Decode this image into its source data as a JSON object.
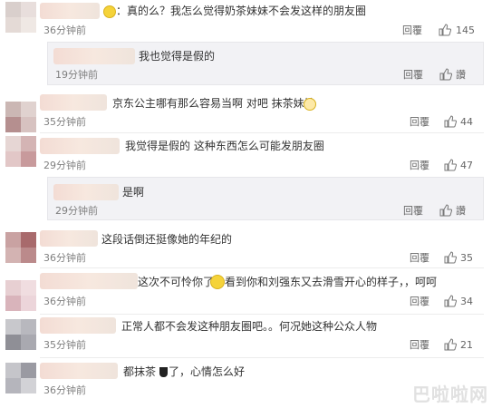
{
  "actions": {
    "reply_label": "回覆",
    "like_label_zan": "讚"
  },
  "comments": [
    {
      "text": "：真的么？我怎么觉得奶茶妹妹不会发这样的朋友圈",
      "time": "36分钟前",
      "likes": "145"
    },
    {
      "text": "我也觉得是假的",
      "time": "19分钟前",
      "likes": ""
    },
    {
      "text": "京东公主哪有那么容易当啊  对吧 抹茶妹妹",
      "time": "35分钟前",
      "likes": "44"
    },
    {
      "text": "我觉得是假的 这种东西怎么可能发朋友圈",
      "time": "29分钟前",
      "likes": "47"
    },
    {
      "text": "是啊",
      "time": "29分钟前",
      "likes": ""
    },
    {
      "text": "这段话倒还挺像她的年纪的",
      "time": "36分钟前",
      "likes": "35"
    },
    {
      "text_a": "这次不可怜你了",
      "text_b": "看到你和刘强东又去滑雪开心的样子，，呵呵",
      "time": "36分钟前",
      "likes": "34"
    },
    {
      "text": "正常人都不会发这种朋友圈吧。。何况她这种公众人物",
      "time": "35分钟前",
      "likes": "21"
    },
    {
      "text_a": "都抹茶",
      "text_b": "了，心情怎么好",
      "time": "36分钟前",
      "likes": ""
    }
  ],
  "watermark": "巴啦啦网"
}
